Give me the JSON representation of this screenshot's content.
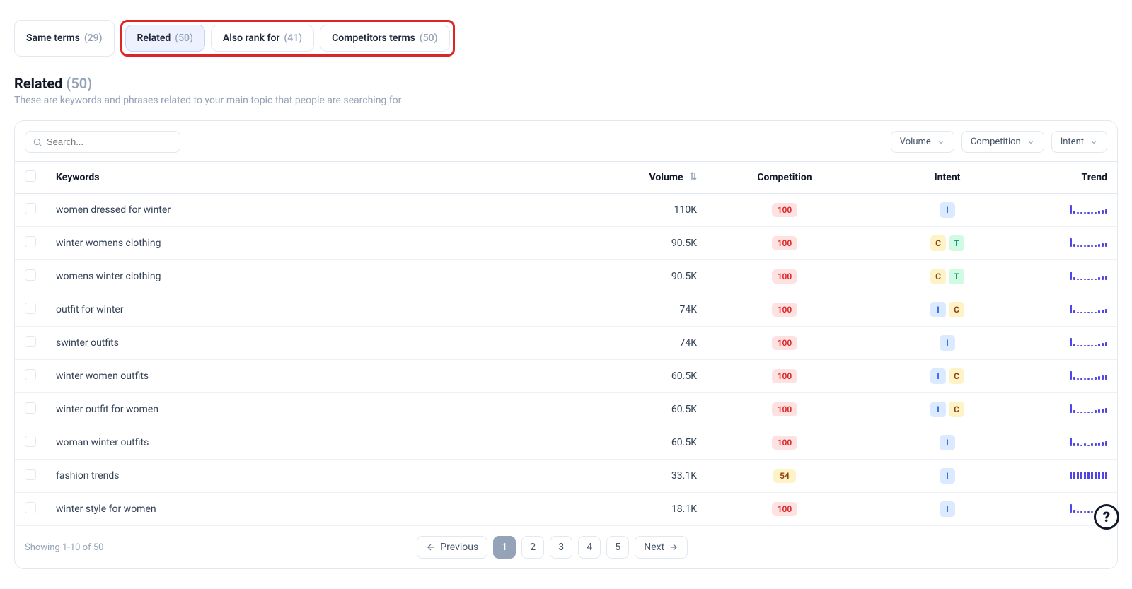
{
  "tabs": [
    {
      "label": "Same terms",
      "count": "(29)",
      "active": false
    },
    {
      "label": "Related",
      "count": "(50)",
      "active": true
    },
    {
      "label": "Also rank for",
      "count": "(41)",
      "active": false
    },
    {
      "label": "Competitors terms",
      "count": "(50)",
      "active": false
    }
  ],
  "section": {
    "title": "Related",
    "count": "(50)",
    "desc": "These are keywords and phrases related to your main topic that people are searching for"
  },
  "search": {
    "placeholder": "Search..."
  },
  "filters": [
    {
      "label": "Volume"
    },
    {
      "label": "Competition"
    },
    {
      "label": "Intent"
    }
  ],
  "columns": {
    "keywords": "Keywords",
    "volume": "Volume",
    "competition": "Competition",
    "intent": "Intent",
    "trend": "Trend"
  },
  "rows": [
    {
      "keyword": "women dressed for winter",
      "volume": "110K",
      "competition": "100",
      "comp_level": "red",
      "intents": [
        "I"
      ],
      "trend": [
        10,
        3,
        2,
        2,
        2,
        2,
        2,
        2,
        3,
        4,
        5
      ]
    },
    {
      "keyword": "winter womens clothing",
      "volume": "90.5K",
      "competition": "100",
      "comp_level": "red",
      "intents": [
        "C",
        "T"
      ],
      "trend": [
        10,
        3,
        2,
        2,
        2,
        2,
        2,
        2,
        3,
        4,
        5
      ]
    },
    {
      "keyword": "womens winter clothing",
      "volume": "90.5K",
      "competition": "100",
      "comp_level": "red",
      "intents": [
        "C",
        "T"
      ],
      "trend": [
        10,
        3,
        2,
        2,
        2,
        2,
        2,
        2,
        3,
        4,
        5
      ]
    },
    {
      "keyword": "outfit for winter",
      "volume": "74K",
      "competition": "100",
      "comp_level": "red",
      "intents": [
        "I",
        "C"
      ],
      "trend": [
        10,
        3,
        2,
        2,
        2,
        2,
        2,
        2,
        3,
        4,
        5
      ]
    },
    {
      "keyword": "swinter outfits",
      "volume": "74K",
      "competition": "100",
      "comp_level": "red",
      "intents": [
        "I"
      ],
      "trend": [
        10,
        3,
        2,
        2,
        2,
        2,
        2,
        2,
        3,
        4,
        5
      ]
    },
    {
      "keyword": "winter women outfits",
      "volume": "60.5K",
      "competition": "100",
      "comp_level": "red",
      "intents": [
        "I",
        "C"
      ],
      "trend": [
        10,
        3,
        2,
        2,
        2,
        2,
        2,
        3,
        4,
        5,
        6
      ]
    },
    {
      "keyword": "winter outfit for women",
      "volume": "60.5K",
      "competition": "100",
      "comp_level": "red",
      "intents": [
        "I",
        "C"
      ],
      "trend": [
        10,
        3,
        2,
        2,
        2,
        2,
        2,
        3,
        4,
        5,
        6
      ]
    },
    {
      "keyword": "woman winter outfits",
      "volume": "60.5K",
      "competition": "100",
      "comp_level": "red",
      "intents": [
        "I"
      ],
      "trend": [
        10,
        4,
        3,
        2,
        3,
        2,
        3,
        3,
        4,
        5,
        6
      ]
    },
    {
      "keyword": "fashion trends",
      "volume": "33.1K",
      "competition": "54",
      "comp_level": "yellow",
      "intents": [
        "I"
      ],
      "trend": [
        9,
        9,
        9,
        9,
        9,
        9,
        9,
        9,
        9,
        9,
        9
      ]
    },
    {
      "keyword": "winter style for women",
      "volume": "18.1K",
      "competition": "100",
      "comp_level": "red",
      "intents": [
        "I"
      ],
      "trend": [
        10,
        3,
        2,
        2,
        2,
        2,
        2,
        2,
        3,
        4,
        5
      ]
    }
  ],
  "footer": {
    "showing": "Showing 1-10 of 50",
    "prev": "Previous",
    "next": "Next",
    "pages": [
      "1",
      "2",
      "3",
      "4",
      "5"
    ],
    "active_page": "1"
  },
  "help": "?"
}
